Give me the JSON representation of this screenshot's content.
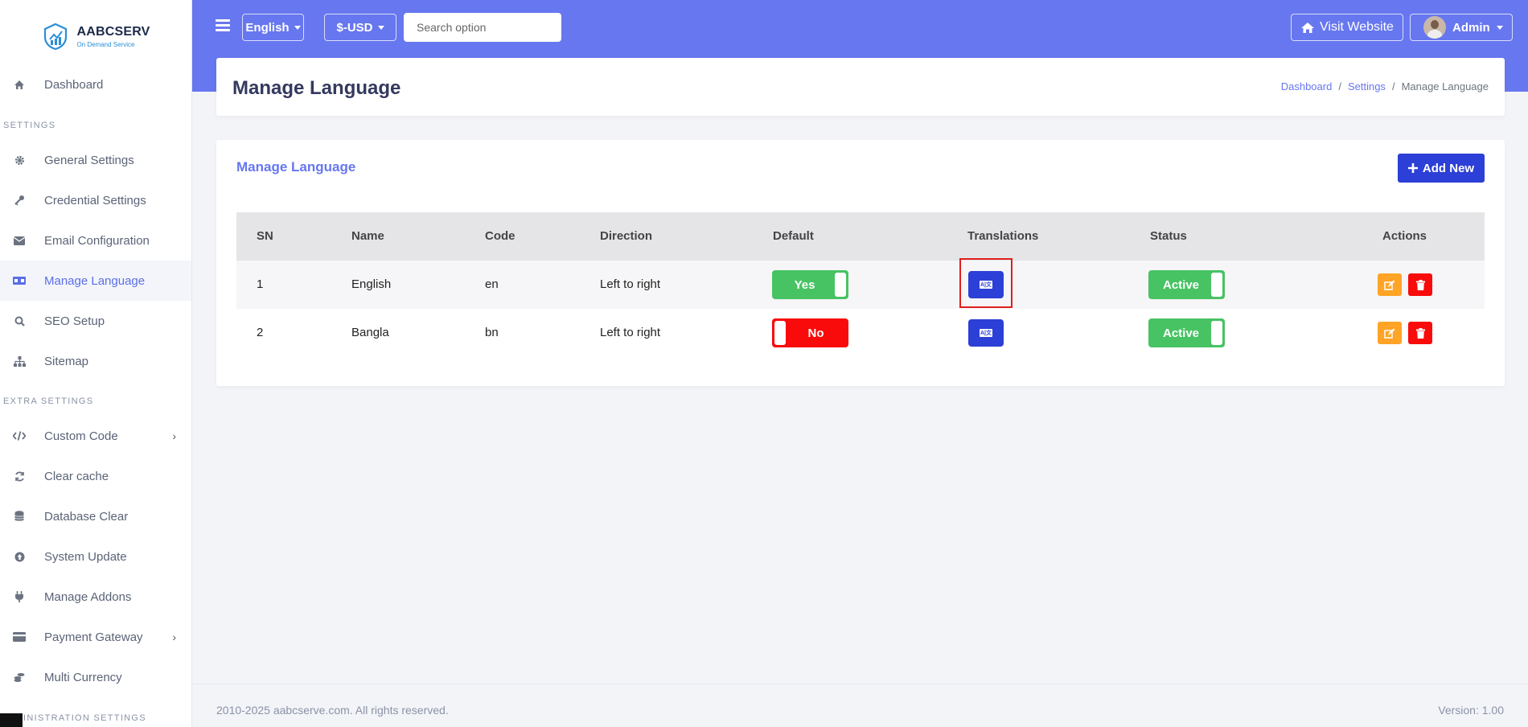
{
  "brand": {
    "name": "AABCSERV",
    "tagline": "On Demand Service"
  },
  "sidebar": {
    "items": [
      {
        "label": "Dashboard",
        "icon": "home-icon"
      },
      {
        "label": "General Settings",
        "icon": "gear-icon"
      },
      {
        "label": "Credential Settings",
        "icon": "key-icon"
      },
      {
        "label": "Email Configuration",
        "icon": "envelope-icon"
      },
      {
        "label": "Manage Language",
        "icon": "language-icon"
      },
      {
        "label": "SEO Setup",
        "icon": "search-icon"
      },
      {
        "label": "Sitemap",
        "icon": "sitemap-icon"
      },
      {
        "label": "Custom Code",
        "icon": "code-icon"
      },
      {
        "label": "Clear cache",
        "icon": "refresh-icon"
      },
      {
        "label": "Database Clear",
        "icon": "database-icon"
      },
      {
        "label": "System Update",
        "icon": "upload-icon"
      },
      {
        "label": "Manage Addons",
        "icon": "plug-icon"
      },
      {
        "label": "Payment Gateway",
        "icon": "credit-card-icon"
      },
      {
        "label": "Multi Currency",
        "icon": "coins-icon"
      }
    ],
    "sections": {
      "settings": "SETTINGS",
      "extra": "EXTRA SETTINGS",
      "admin": "INISTRATION SETTINGS"
    }
  },
  "topbar": {
    "language": "English",
    "currency": "$-USD",
    "search_placeholder": "Search option",
    "visit_website": "Visit Website",
    "admin": "Admin"
  },
  "header": {
    "title": "Manage Language",
    "breadcrumb": [
      "Dashboard",
      "Settings",
      "Manage Language"
    ],
    "separator": "/"
  },
  "card": {
    "title": "Manage Language",
    "add_button": "Add New"
  },
  "table": {
    "columns": [
      "SN",
      "Name",
      "Code",
      "Direction",
      "Default",
      "Translations",
      "Status",
      "Actions"
    ],
    "rows": [
      {
        "sn": "1",
        "name": "English",
        "code": "en",
        "direction": "Left to right",
        "default": "Yes",
        "status": "Active"
      },
      {
        "sn": "2",
        "name": "Bangla",
        "code": "bn",
        "direction": "Left to right",
        "default": "No",
        "status": "Active"
      }
    ]
  },
  "footer": {
    "copyright": "2010-2025 aabcserve.com. All rights reserved.",
    "version": "Version: 1.00"
  },
  "colors": {
    "primary": "#6777ef",
    "button_blue": "#2c3fd6",
    "success": "#47c363",
    "danger": "#fa0b0b",
    "warning": "#ffa426"
  }
}
